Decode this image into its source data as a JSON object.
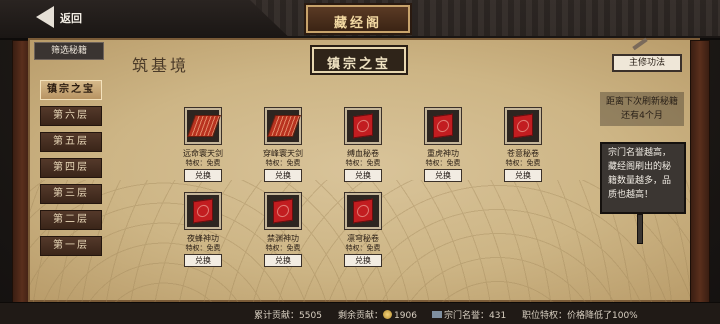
{
  "header": {
    "back_label": "返回",
    "title": "藏经阁"
  },
  "filter_label": "筛选秘籍",
  "realm": "筑基境",
  "section_title": "镇宗之宝",
  "tabs": [
    "镇宗之宝",
    "第六层",
    "第五层",
    "第四层",
    "第三层",
    "第二层",
    "第一层"
  ],
  "active_tab": "镇宗之宝",
  "right": {
    "main_skill_button": "主修功法",
    "refresh_line1": "距离下次刷新秘籍",
    "refresh_line2": "还有4个月",
    "note": "宗门名誉越高，藏经阁刷出的秘籍数量越多，品质也越高！"
  },
  "items": [
    {
      "name": "远命寰天剑",
      "priv": "特权：免费",
      "button": "兑换",
      "icon": "scroll-book-icon"
    },
    {
      "name": "穿峰寰天剑",
      "priv": "特权：免费",
      "button": "兑换",
      "icon": "scroll-book-icon"
    },
    {
      "name": "缚血秘卷",
      "priv": "特权：免费",
      "button": "兑换",
      "icon": "red-book-icon"
    },
    {
      "name": "重虎神功",
      "priv": "特权：免费",
      "button": "兑换",
      "icon": "red-book-icon"
    },
    {
      "name": "苍意秘卷",
      "priv": "特权：免费",
      "button": "兑换",
      "icon": "red-book-icon"
    },
    {
      "name": "夜蜂神功",
      "priv": "特权：免费",
      "button": "兑换",
      "icon": "red-book-icon"
    },
    {
      "name": "禁渊神功",
      "priv": "特权：免费",
      "button": "兑换",
      "icon": "red-book-icon"
    },
    {
      "name": "凛穹秘卷",
      "priv": "特权：免费",
      "button": "兑换",
      "icon": "red-book-icon"
    }
  ],
  "stats": {
    "total_contribution_label": "累计贡献：",
    "total_contribution": "5505",
    "remaining_contribution_label": "剩余贡献：",
    "remaining_contribution": "1906",
    "sect_reputation_label": "宗门名誉：",
    "sect_reputation": "431",
    "privilege_text": "职位特权：价格降低了100%"
  },
  "colors": {
    "parchment": "#cdb585",
    "frame": "#5a2f1c",
    "book": "#c21d20",
    "active_tab": "#d6b98a"
  }
}
